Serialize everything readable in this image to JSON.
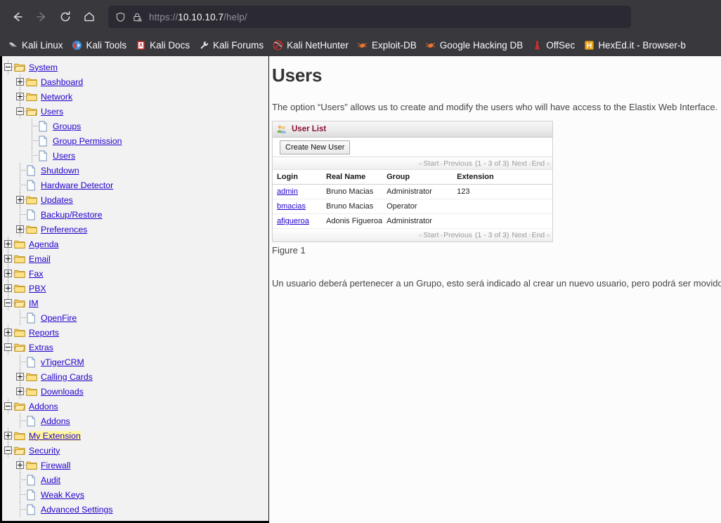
{
  "browser": {
    "nav": {
      "back": "back-arrow",
      "forward": "forward-arrow",
      "reload": "reload",
      "home": "home"
    },
    "url": {
      "scheme": "https://",
      "host": "10.10.10.7",
      "path": "/help/",
      "full": "https://10.10.10.7/help/",
      "shield_icon": "shield-icon",
      "lock_warning_icon": "lock-warning-icon"
    },
    "bookmarks": [
      {
        "label": "Kali Linux",
        "icon": "kali-dragon-icon",
        "color": "#cfcfd4"
      },
      {
        "label": "Kali Tools",
        "icon": "kali-tools-icon",
        "color": "#3a8fd8"
      },
      {
        "label": "Kali Docs",
        "icon": "kali-docs-icon",
        "color": "#c9302c"
      },
      {
        "label": "Kali Forums",
        "icon": "wrench-icon",
        "color": "#d8d8dc"
      },
      {
        "label": "Kali NetHunter",
        "icon": "nethunter-icon",
        "color": "#c9302c"
      },
      {
        "label": "Exploit-DB",
        "icon": "exploit-db-icon",
        "color": "#e8762c"
      },
      {
        "label": "Google Hacking DB",
        "icon": "ghdb-icon",
        "color": "#e8762c"
      },
      {
        "label": "OffSec",
        "icon": "offsec-icon",
        "color": "#c9302c"
      },
      {
        "label": "HexEd.it - Browser-b",
        "icon": "hexedit-icon",
        "color": "#e8a317"
      }
    ]
  },
  "sidebar": {
    "tree": [
      {
        "label": "System",
        "depth": 0,
        "type": "folder",
        "toggle": "minus"
      },
      {
        "label": "Dashboard",
        "depth": 1,
        "type": "folder",
        "toggle": "plus"
      },
      {
        "label": "Network",
        "depth": 1,
        "type": "folder",
        "toggle": "plus"
      },
      {
        "label": "Users",
        "depth": 1,
        "type": "folder",
        "toggle": "minus"
      },
      {
        "label": "Groups",
        "depth": 2,
        "type": "file",
        "toggle": "none"
      },
      {
        "label": "Group Permission",
        "depth": 2,
        "type": "file",
        "toggle": "none"
      },
      {
        "label": "Users",
        "depth": 2,
        "type": "file",
        "toggle": "none"
      },
      {
        "label": "Shutdown",
        "depth": 1,
        "type": "file",
        "toggle": "none"
      },
      {
        "label": "Hardware Detector",
        "depth": 1,
        "type": "file",
        "toggle": "none"
      },
      {
        "label": "Updates",
        "depth": 1,
        "type": "folder",
        "toggle": "plus"
      },
      {
        "label": "Backup/Restore",
        "depth": 1,
        "type": "file",
        "toggle": "none"
      },
      {
        "label": "Preferences",
        "depth": 1,
        "type": "folder",
        "toggle": "plus"
      },
      {
        "label": "Agenda",
        "depth": 0,
        "type": "folder",
        "toggle": "plus"
      },
      {
        "label": "Email",
        "depth": 0,
        "type": "folder",
        "toggle": "plus"
      },
      {
        "label": "Fax",
        "depth": 0,
        "type": "folder",
        "toggle": "plus"
      },
      {
        "label": "PBX",
        "depth": 0,
        "type": "folder",
        "toggle": "plus"
      },
      {
        "label": "IM",
        "depth": 0,
        "type": "folder",
        "toggle": "minus"
      },
      {
        "label": "OpenFire",
        "depth": 1,
        "type": "file",
        "toggle": "none"
      },
      {
        "label": "Reports",
        "depth": 0,
        "type": "folder",
        "toggle": "plus"
      },
      {
        "label": "Extras",
        "depth": 0,
        "type": "folder",
        "toggle": "minus"
      },
      {
        "label": "vTigerCRM",
        "depth": 1,
        "type": "file",
        "toggle": "none"
      },
      {
        "label": "Calling Cards",
        "depth": 1,
        "type": "folder",
        "toggle": "plus"
      },
      {
        "label": "Downloads",
        "depth": 1,
        "type": "folder",
        "toggle": "plus"
      },
      {
        "label": "Addons",
        "depth": 0,
        "type": "folder",
        "toggle": "minus"
      },
      {
        "label": "Addons",
        "depth": 1,
        "type": "file",
        "toggle": "none"
      },
      {
        "label": "My Extension",
        "depth": 0,
        "type": "folder",
        "toggle": "plus",
        "highlight": true
      },
      {
        "label": "Security",
        "depth": 0,
        "type": "folder",
        "toggle": "minus"
      },
      {
        "label": "Firewall",
        "depth": 1,
        "type": "folder",
        "toggle": "plus"
      },
      {
        "label": "Audit",
        "depth": 1,
        "type": "file",
        "toggle": "none"
      },
      {
        "label": "Weak Keys",
        "depth": 1,
        "type": "file",
        "toggle": "none"
      },
      {
        "label": "Advanced Settings",
        "depth": 1,
        "type": "file",
        "toggle": "none"
      }
    ]
  },
  "content": {
    "title": "Users",
    "intro": "The option “Users” allows us to create and modify the users who will have access to the Elastix Web Interface.",
    "figure_caption": "Figure 1",
    "body_text": "Un usuario deberá pertenecer a un Grupo, esto será indicado al crear un nuevo usuario, pero podrá ser movido",
    "panel": {
      "title": "User List",
      "title_color": "#8c1233",
      "icon": "users-group-icon",
      "create_button": "Create New User",
      "pager": {
        "start": "Start",
        "previous": "Previous",
        "range": "(1 - 3 of 3)",
        "next": "Next",
        "end": "End",
        "first_chevron": "«",
        "prev_chevron": "‹",
        "next_chevron": "›",
        "last_chevron": "»"
      },
      "columns": [
        "Login",
        "Real Name",
        "Group",
        "Extension"
      ],
      "rows": [
        {
          "login": "admin",
          "real_name": "Bruno Macias",
          "group": "Administrator",
          "extension": "123"
        },
        {
          "login": "bmacias",
          "real_name": "Bruno Macias",
          "group": "Operator",
          "extension": ""
        },
        {
          "login": "afigueroa",
          "real_name": "Adonis Figueroa",
          "group": "Administrator",
          "extension": ""
        }
      ]
    }
  }
}
